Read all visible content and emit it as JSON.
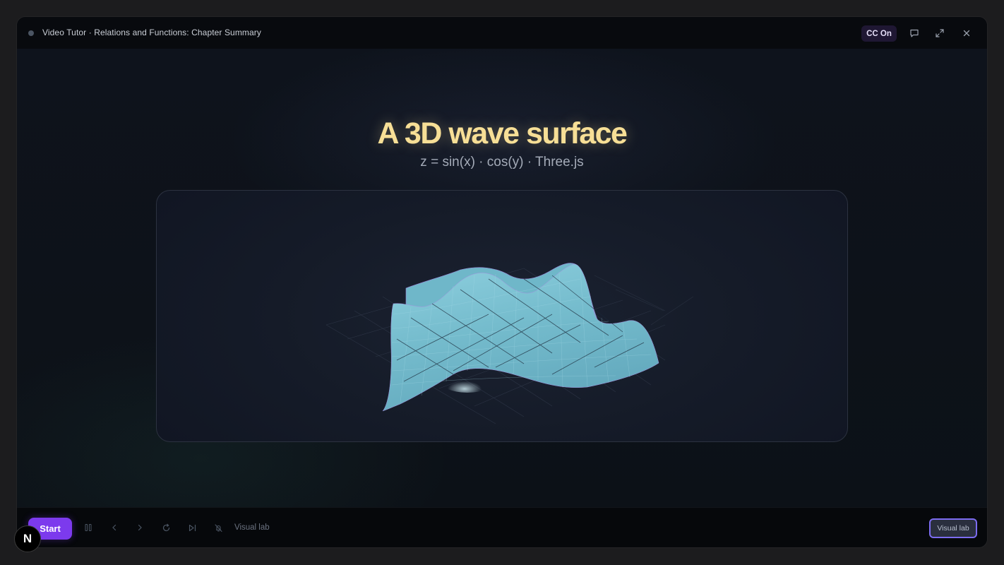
{
  "window": {
    "title": "Video Tutor · Relations and Functions: Chapter Summary",
    "cc_label": "CC On"
  },
  "icons": {
    "status": "status-dot",
    "chat": "chat-bubble-icon",
    "expand": "expand-icon",
    "close": "close-icon",
    "pause": "pause-icon",
    "prev": "chevron-left-icon",
    "next": "chevron-right-icon",
    "replay": "rotate-icon",
    "skip": "skip-forward-icon",
    "mute": "bell-off-icon",
    "badge": "n-logo"
  },
  "stage": {
    "heading": "A 3D wave surface",
    "subheading": "z = sin(x) · cos(y) · Three.js"
  },
  "controls": {
    "start_label": "Start",
    "mode_label": "Visual lab",
    "mode_button_label": "Visual lab"
  },
  "badge": {
    "letter": "N"
  },
  "colors": {
    "accent": "#7c3aed",
    "heading": "#f7df96",
    "surface": "#7cc4d6"
  }
}
